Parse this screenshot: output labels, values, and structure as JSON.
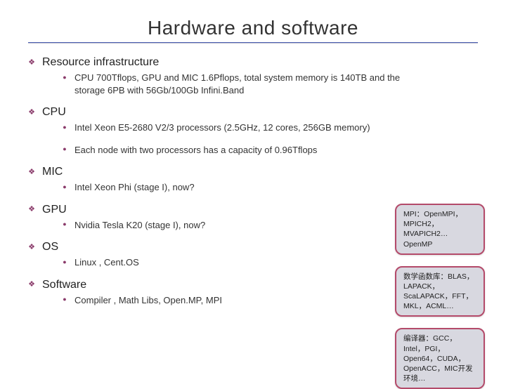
{
  "title": "Hardware and software",
  "sections": [
    {
      "heading": "Resource infrastructure",
      "items": [
        "CPU 700Tflops, GPU and MIC 1.6Pflops, total system memory is 140TB and the storage 6PB with 56Gb/100Gb Infini.Band"
      ]
    },
    {
      "heading": "CPU",
      "items": [
        "Intel Xeon E5-2680 V2/3 processors (2.5GHz, 12 cores, 256GB memory)",
        "Each node with two processors has a capacity of 0.96Tflops"
      ]
    },
    {
      "heading": "MIC",
      "items": [
        "Intel Xeon Phi (stage I), now?"
      ]
    },
    {
      "heading": "GPU",
      "items": [
        "Nvidia Tesla K20 (stage I), now?"
      ]
    },
    {
      "heading": "OS",
      "items": [
        "Linux , Cent.OS"
      ]
    },
    {
      "heading": "Software",
      "items": [
        "Compiler , Math Libs, Open.MP, MPI"
      ]
    }
  ],
  "side_boxes": [
    "MPI：OpenMPI，MPICH2，MVAPICH2…\nOpenMP",
    "数学函数库：BLAS，LAPACK，ScaLAPACK，FFT，MKL，ACML…",
    "编译器：GCC，Intel，PGI，Open64，CUDA，OpenACC，MIC开发环境…"
  ]
}
